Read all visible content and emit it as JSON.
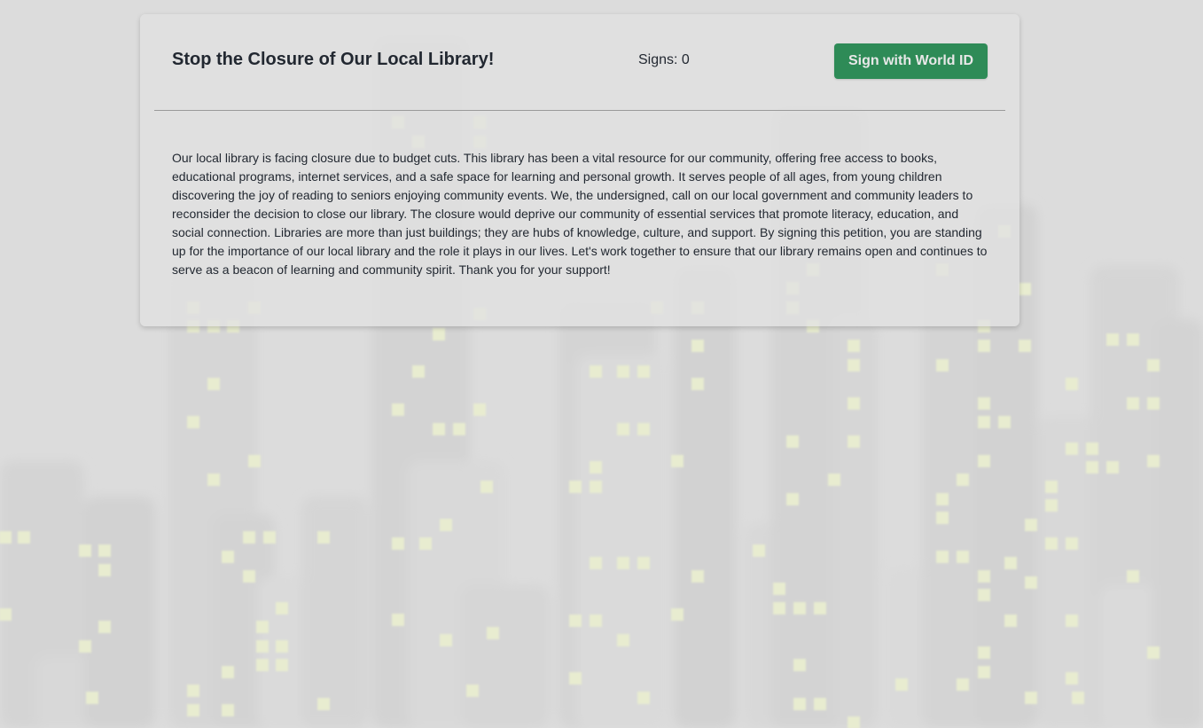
{
  "petition": {
    "title": "Stop the Closure of Our Local Library!",
    "signs_label": "Signs: 0",
    "signs_count": 0,
    "sign_button_label": "Sign with World ID",
    "description": "Our local library is facing closure due to budget cuts. This library has been a vital resource for our community, offering free access to books, educational programs, internet services, and a safe space for learning and personal growth. It serves people of all ages, from young children discovering the joy of reading to seniors enjoying community events. We, the undersigned, call on our local government and community leaders to reconsider the decision to close our library. The closure would deprive our community of essential services that promote literacy, education, and social connection. Libraries are more than just buildings; they are hubs of knowledge, culture, and support. By signing this petition, you are standing up for the importance of our local library and the role it plays in our lives. Let's work together to ensure that our library remains open and continues to serve as a beacon of learning and community spirit. Thank you for your support!"
  },
  "colors": {
    "page_background": "#dcdcdc",
    "button_background": "#2e8b57",
    "button_text": "#e8e8e8",
    "text": "#222831",
    "window_light": "#e8ecd0"
  }
}
